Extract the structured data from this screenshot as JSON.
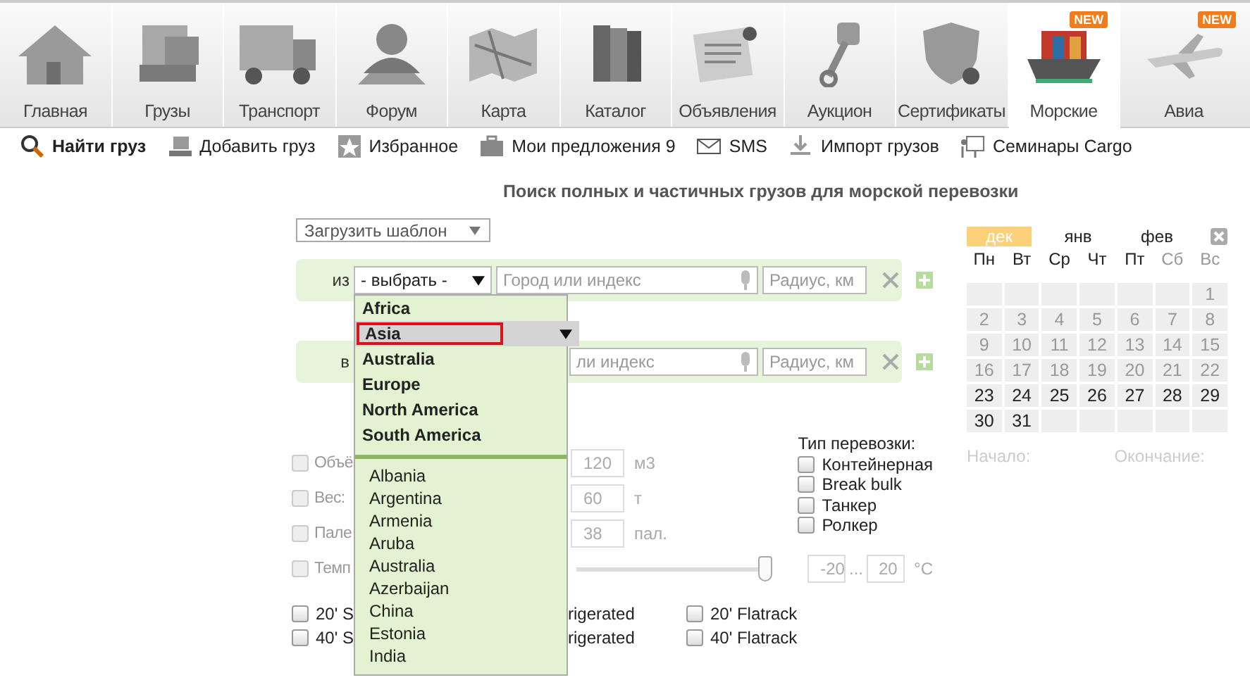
{
  "tabs": [
    {
      "label": "Главная",
      "kind": "house",
      "selected": false
    },
    {
      "label": "Грузы",
      "kind": "boxes",
      "selected": false
    },
    {
      "label": "Транспорт",
      "kind": "truck",
      "selected": false
    },
    {
      "label": "Форум",
      "kind": "person",
      "selected": false
    },
    {
      "label": "Карта",
      "kind": "map",
      "selected": false
    },
    {
      "label": "Каталог",
      "kind": "books",
      "selected": false
    },
    {
      "label": "Объявления",
      "kind": "newspaper",
      "selected": false
    },
    {
      "label": "Аукцион",
      "kind": "piston",
      "selected": false
    },
    {
      "label": "Сертификаты",
      "kind": "shield",
      "selected": false
    },
    {
      "label": "Морские",
      "kind": "ship",
      "selected": true,
      "badge": "NEW"
    },
    {
      "label": "Авиа",
      "kind": "plane",
      "selected": false,
      "badge": "NEW"
    }
  ],
  "toolbar": [
    {
      "label": "Найти груз",
      "kind": "search",
      "selected": true
    },
    {
      "label": "Добавить груз",
      "kind": "computer",
      "selected": false
    },
    {
      "label": "Избранное",
      "kind": "star",
      "selected": false
    },
    {
      "label": "Мои предложения 9",
      "kind": "briefcase",
      "selected": false
    },
    {
      "label": "SMS",
      "kind": "envelope",
      "selected": false
    },
    {
      "label": "Импорт грузов",
      "kind": "download",
      "selected": false
    },
    {
      "label": "Семинары Cargo",
      "kind": "board",
      "selected": false
    }
  ],
  "heading": "Поиск полных и частичных грузов для морской перевозки",
  "template_select": "Загрузить шаблон",
  "from_row": {
    "label": "из",
    "select": "- выбрать -",
    "city_placeholder": "Город или индекс",
    "radius_placeholder": "Радиус, км"
  },
  "to_row": {
    "label": "в",
    "city_placeholder": "ли индекс",
    "radius_placeholder": "Радиус, км"
  },
  "dropdown": {
    "regions": [
      {
        "label": "Africa",
        "selected": false
      },
      {
        "label": "Asia",
        "selected": true
      },
      {
        "label": "Australia",
        "selected": false
      },
      {
        "label": "Europe",
        "selected": false
      },
      {
        "label": "North America",
        "selected": false
      },
      {
        "label": "South America",
        "selected": false
      }
    ],
    "countries": [
      "Albania",
      "Argentina",
      "Armenia",
      "Aruba",
      "Australia",
      "Azerbaijan",
      "China",
      "Estonia",
      "India"
    ]
  },
  "cargo_params": [
    {
      "label": "Объё",
      "value": "120",
      "unit": "м3",
      "checked": false
    },
    {
      "label": "Вес:",
      "value": "60",
      "unit": "т",
      "checked": false
    },
    {
      "label": "Пале",
      "value": "38",
      "unit": "пал.",
      "checked": false
    }
  ],
  "transport_type": {
    "title": "Тип перевозки:",
    "options": [
      {
        "label": "Контейнерная",
        "checked": false
      },
      {
        "label": "Break bulk",
        "checked": false
      },
      {
        "label": "Танкер",
        "checked": false
      },
      {
        "label": "Ролкер",
        "checked": false
      }
    ]
  },
  "temperature": {
    "label": "Темп",
    "checked": false,
    "level": 1,
    "min": "-20",
    "separator": "...",
    "max": "20",
    "unit": "°C"
  },
  "containers": [
    [
      {
        "label": "20' S",
        "checked": false
      },
      {
        "label": "rigerated"
      },
      {
        "label": "20' Flatrack",
        "checked": false
      }
    ],
    [
      {
        "label": "40' S",
        "checked": false
      },
      {
        "label": "rigerated"
      },
      {
        "label": "40' Flatrack",
        "checked": false
      }
    ]
  ],
  "calendar": {
    "months": [
      {
        "label": "дек",
        "selected": true
      },
      {
        "label": "янв",
        "selected": false
      },
      {
        "label": "фев",
        "selected": false
      }
    ],
    "weekdays": [
      {
        "label": "Пн",
        "weekend": false
      },
      {
        "label": "Вт",
        "weekend": false
      },
      {
        "label": "Ср",
        "weekend": false
      },
      {
        "label": "Чт",
        "weekend": false
      },
      {
        "label": "Пт",
        "weekend": false
      },
      {
        "label": "Сб",
        "weekend": true
      },
      {
        "label": "Вс",
        "weekend": true
      }
    ],
    "weeks": [
      [
        {
          "kind": "blank"
        },
        {
          "kind": "blank"
        },
        {
          "kind": "blank"
        },
        {
          "kind": "blank"
        },
        {
          "kind": "blank"
        },
        {
          "kind": "blank"
        },
        {
          "day": "1",
          "disabled": true
        }
      ],
      [
        {
          "day": "2",
          "disabled": true
        },
        {
          "day": "3",
          "disabled": true
        },
        {
          "day": "4",
          "disabled": true
        },
        {
          "day": "5",
          "disabled": true
        },
        {
          "day": "6",
          "disabled": true
        },
        {
          "day": "7",
          "disabled": true
        },
        {
          "day": "8",
          "disabled": true
        }
      ],
      [
        {
          "day": "9",
          "disabled": true
        },
        {
          "day": "10",
          "disabled": true
        },
        {
          "day": "11",
          "disabled": true
        },
        {
          "day": "12",
          "disabled": true
        },
        {
          "day": "13",
          "disabled": true
        },
        {
          "day": "14",
          "disabled": true
        },
        {
          "day": "15",
          "disabled": true
        }
      ],
      [
        {
          "day": "16",
          "disabled": true
        },
        {
          "day": "17",
          "disabled": true
        },
        {
          "day": "18",
          "disabled": true
        },
        {
          "day": "19",
          "disabled": true
        },
        {
          "day": "20",
          "disabled": true
        },
        {
          "day": "21",
          "disabled": true
        },
        {
          "day": "22",
          "disabled": true
        }
      ],
      [
        {
          "day": "23",
          "disabled": false
        },
        {
          "day": "24",
          "disabled": false
        },
        {
          "day": "25",
          "disabled": false
        },
        {
          "day": "26",
          "disabled": false
        },
        {
          "day": "27",
          "disabled": false
        },
        {
          "day": "28",
          "disabled": false
        },
        {
          "day": "29",
          "disabled": false
        }
      ],
      [
        {
          "day": "30",
          "disabled": false
        },
        {
          "day": "31",
          "disabled": false
        },
        {
          "kind": "blank"
        },
        {
          "kind": "blank"
        },
        {
          "kind": "blank"
        },
        {
          "kind": "blank"
        },
        {
          "kind": "blank"
        }
      ]
    ],
    "start_label": "Начало:",
    "end_label": "Окончание:"
  }
}
